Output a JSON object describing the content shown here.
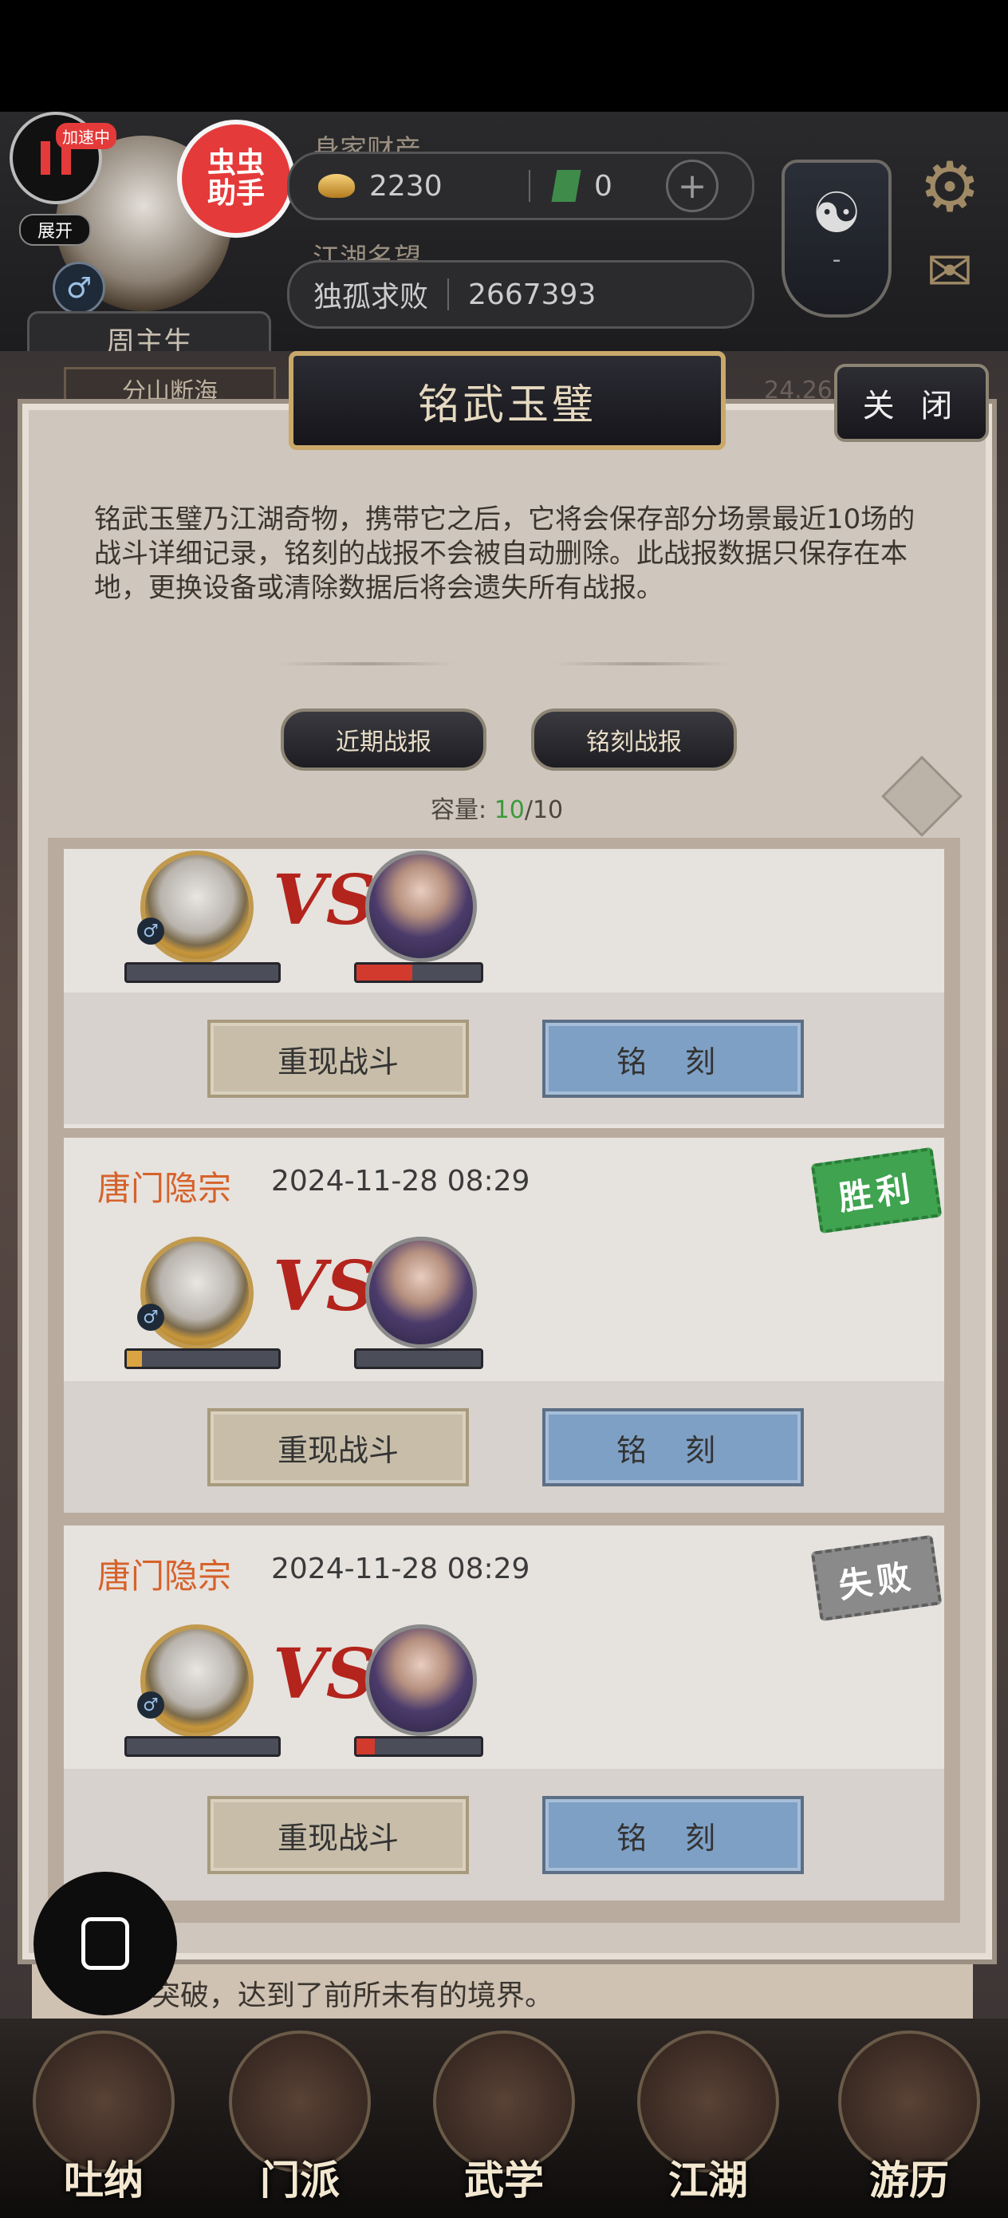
{
  "header": {
    "badge_speeding": "加速中",
    "expand_label": "展开",
    "assistant_label": "虫虫\n助手",
    "wealth_label": "身家财产",
    "gold": "2230",
    "jade": "0",
    "fame_label": "江湖名望",
    "fame_title": "独孤求败",
    "fame_value": "2667393",
    "player_name": "周主生",
    "player_sub": "分山断海"
  },
  "background_texts": {
    "line1": "突破，达到了前所未有的境界。",
    "right_number": "24.26"
  },
  "modal": {
    "title": "铭武玉璧",
    "close_label": "关 闭",
    "description": "铭武玉璧乃江湖奇物，携带它之后，它将会保存部分场景最近10场的战斗详细记录，铭刻的战报不会被自动删除。此战报数据只保存在本地，更换设备或清除数据后将会遗失所有战报。",
    "tabs": [
      "近期战报",
      "铭刻战报"
    ],
    "capacity_label": "容量:",
    "capacity_current": "10",
    "capacity_max": "/10"
  },
  "battles": [
    {
      "guild": "",
      "date": "",
      "result": "",
      "player_hp": 0,
      "enemy_hp": 0.45,
      "replay_label": "重现战斗",
      "engrave_label": "铭 刻"
    },
    {
      "guild": "唐门隐宗",
      "date": "2024-11-28 08:29",
      "result": "胜利",
      "player_hp": 0.1,
      "enemy_hp": 0,
      "replay_label": "重现战斗",
      "engrave_label": "铭 刻"
    },
    {
      "guild": "唐门隐宗",
      "date": "2024-11-28 08:29",
      "result": "失败",
      "player_hp": 0,
      "enemy_hp": 0.15,
      "replay_label": "重现战斗",
      "engrave_label": "铭 刻"
    }
  ],
  "vs_label": "VS",
  "nav": [
    "吐纳",
    "门派",
    "武学",
    "江湖",
    "游历"
  ],
  "colors": {
    "accent_win": "#3fa34f",
    "accent_lose": "#8a8a8a",
    "hp_red": "#d23a2e",
    "hp_gold": "#d9a441",
    "guild_orange": "#d6622a"
  }
}
